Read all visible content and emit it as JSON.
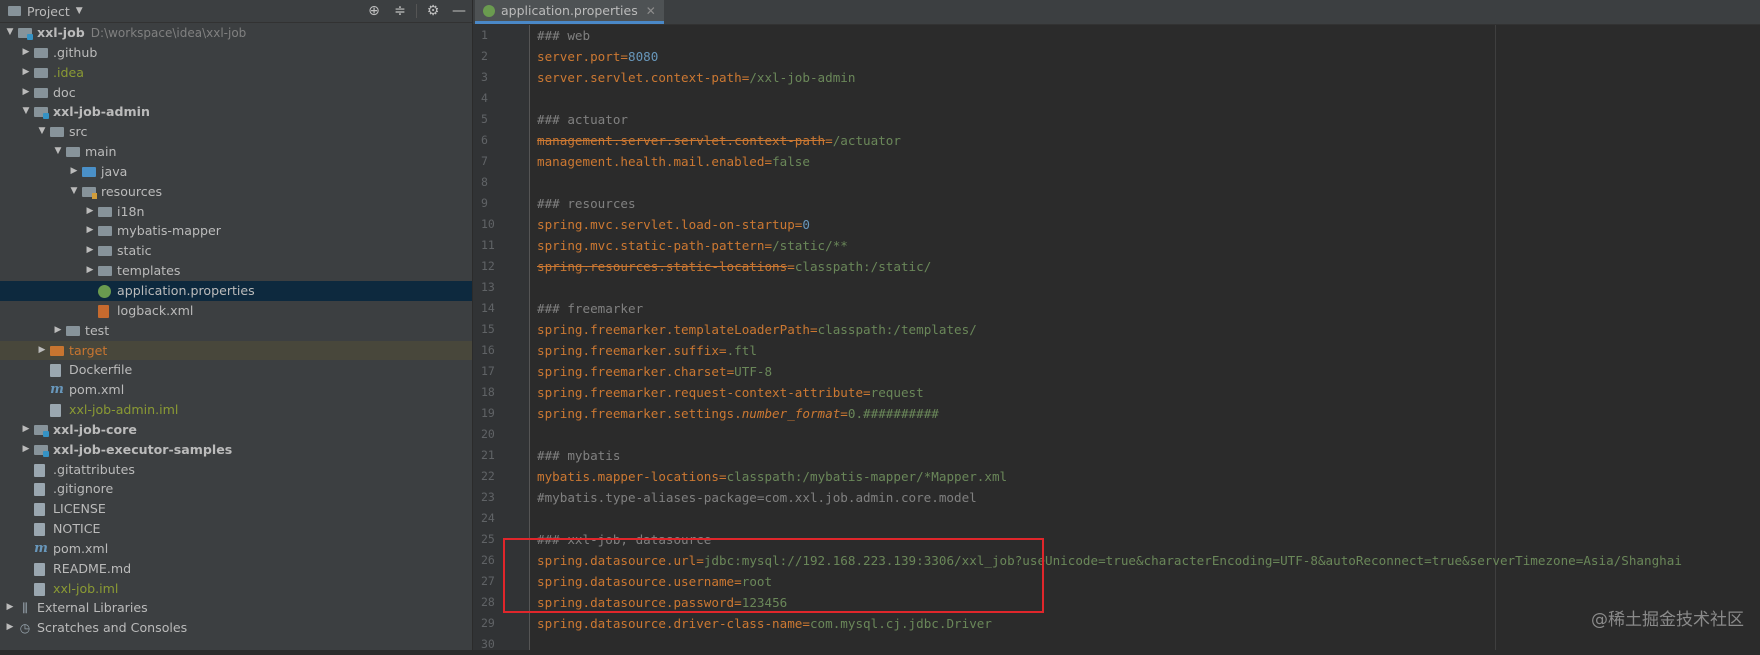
{
  "project_panel": {
    "title": "Project",
    "tree": [
      {
        "label": "xxl-job",
        "hint": "D:\\workspace\\idea\\xxl-job",
        "depth": 0,
        "type": "module",
        "expanded": true,
        "style": "bold"
      },
      {
        "label": ".github",
        "depth": 1,
        "type": "folder",
        "expanded": false,
        "style": "light"
      },
      {
        "label": ".idea",
        "depth": 1,
        "type": "folder",
        "expanded": false,
        "style": "green"
      },
      {
        "label": "doc",
        "depth": 1,
        "type": "folder",
        "expanded": false,
        "style": "light"
      },
      {
        "label": "xxl-job-admin",
        "depth": 1,
        "type": "module",
        "expanded": true,
        "style": "bold"
      },
      {
        "label": "src",
        "depth": 2,
        "type": "folder",
        "expanded": true,
        "style": "light"
      },
      {
        "label": "main",
        "depth": 3,
        "type": "folder",
        "expanded": true,
        "style": "light"
      },
      {
        "label": "java",
        "depth": 4,
        "type": "src",
        "expanded": false,
        "style": "light"
      },
      {
        "label": "resources",
        "depth": 4,
        "type": "res",
        "expanded": true,
        "style": "light"
      },
      {
        "label": "i18n",
        "depth": 5,
        "type": "folder",
        "expanded": false,
        "style": "light"
      },
      {
        "label": "mybatis-mapper",
        "depth": 5,
        "type": "folder",
        "expanded": false,
        "style": "light"
      },
      {
        "label": "static",
        "depth": 5,
        "type": "folder",
        "expanded": false,
        "style": "light"
      },
      {
        "label": "templates",
        "depth": 5,
        "type": "folder",
        "expanded": false,
        "style": "light"
      },
      {
        "label": "application.properties",
        "depth": 5,
        "type": "props",
        "style": "light",
        "selected": true
      },
      {
        "label": "logback.xml",
        "depth": 5,
        "type": "xml",
        "style": "light"
      },
      {
        "label": "test",
        "depth": 3,
        "type": "folder",
        "expanded": false,
        "style": "light"
      },
      {
        "label": "target",
        "depth": 2,
        "type": "excl",
        "expanded": false,
        "style": "orange",
        "excluded": true
      },
      {
        "label": "Dockerfile",
        "depth": 2,
        "type": "file",
        "style": "light"
      },
      {
        "label": "pom.xml",
        "depth": 2,
        "type": "pom",
        "style": "light"
      },
      {
        "label": "xxl-job-admin.iml",
        "depth": 2,
        "type": "iml",
        "style": "green"
      },
      {
        "label": "xxl-job-core",
        "depth": 1,
        "type": "module",
        "expanded": false,
        "style": "bold"
      },
      {
        "label": "xxl-job-executor-samples",
        "depth": 1,
        "type": "module",
        "expanded": false,
        "style": "bold"
      },
      {
        "label": ".gitattributes",
        "depth": 1,
        "type": "file",
        "style": "light"
      },
      {
        "label": ".gitignore",
        "depth": 1,
        "type": "file",
        "style": "light"
      },
      {
        "label": "LICENSE",
        "depth": 1,
        "type": "file",
        "style": "light"
      },
      {
        "label": "NOTICE",
        "depth": 1,
        "type": "file",
        "style": "light"
      },
      {
        "label": "pom.xml",
        "depth": 1,
        "type": "pom",
        "style": "light"
      },
      {
        "label": "README.md",
        "depth": 1,
        "type": "md",
        "style": "light"
      },
      {
        "label": "xxl-job.iml",
        "depth": 1,
        "type": "iml",
        "style": "green"
      },
      {
        "label": "External Libraries",
        "depth": 0,
        "type": "lib",
        "expanded": false,
        "style": "light"
      },
      {
        "label": "Scratches and Consoles",
        "depth": 0,
        "type": "scratch",
        "expanded": false,
        "style": "light"
      }
    ]
  },
  "editor": {
    "tab_label": "application.properties",
    "lines": [
      {
        "n": "1",
        "parts": [
          [
            "cmt",
            "### web"
          ]
        ]
      },
      {
        "n": "2",
        "parts": [
          [
            "key",
            "server.port"
          ],
          [
            "eq",
            "="
          ],
          [
            "num",
            "8080"
          ]
        ]
      },
      {
        "n": "3",
        "parts": [
          [
            "key",
            "server.servlet.context-path"
          ],
          [
            "eq",
            "="
          ],
          [
            "val",
            "/xxl-job-admin"
          ]
        ]
      },
      {
        "n": "4",
        "parts": []
      },
      {
        "n": "5",
        "parts": [
          [
            "cmt",
            "### actuator"
          ]
        ]
      },
      {
        "n": "6",
        "parts": [
          [
            "key strike",
            "management.server.servlet.context-path"
          ],
          [
            "eq",
            "="
          ],
          [
            "val",
            "/actuator"
          ]
        ]
      },
      {
        "n": "7",
        "parts": [
          [
            "key",
            "management.health.mail.enabled"
          ],
          [
            "eq",
            "="
          ],
          [
            "val",
            "false"
          ]
        ]
      },
      {
        "n": "8",
        "parts": []
      },
      {
        "n": "9",
        "parts": [
          [
            "cmt",
            "### resources"
          ]
        ]
      },
      {
        "n": "10",
        "parts": [
          [
            "key",
            "spring.mvc.servlet.load-on-startup"
          ],
          [
            "eq",
            "="
          ],
          [
            "num",
            "0"
          ]
        ]
      },
      {
        "n": "11",
        "parts": [
          [
            "key",
            "spring.mvc.static-path-pattern"
          ],
          [
            "eq",
            "="
          ],
          [
            "val",
            "/static/**"
          ]
        ]
      },
      {
        "n": "12",
        "parts": [
          [
            "key strike",
            "spring.resources.static-locations"
          ],
          [
            "eq",
            "="
          ],
          [
            "val",
            "classpath:/static/"
          ]
        ]
      },
      {
        "n": "13",
        "parts": []
      },
      {
        "n": "14",
        "parts": [
          [
            "cmt",
            "### freemarker"
          ]
        ]
      },
      {
        "n": "15",
        "parts": [
          [
            "key",
            "spring.freemarker.templateLoaderPath"
          ],
          [
            "eq",
            "="
          ],
          [
            "val",
            "classpath:/templates/"
          ]
        ]
      },
      {
        "n": "16",
        "parts": [
          [
            "key",
            "spring.freemarker.suffix"
          ],
          [
            "eq",
            "="
          ],
          [
            "val",
            ".ftl"
          ]
        ]
      },
      {
        "n": "17",
        "parts": [
          [
            "key",
            "spring.freemarker.charset"
          ],
          [
            "eq",
            "="
          ],
          [
            "val",
            "UTF-8"
          ]
        ]
      },
      {
        "n": "18",
        "parts": [
          [
            "key",
            "spring.freemarker.request-context-attribute"
          ],
          [
            "eq",
            "="
          ],
          [
            "val",
            "request"
          ]
        ]
      },
      {
        "n": "19",
        "parts": [
          [
            "key",
            "spring.freemarker.settings."
          ],
          [
            "key ital",
            "number_format"
          ],
          [
            "eq",
            "="
          ],
          [
            "val",
            "0.##########"
          ]
        ]
      },
      {
        "n": "20",
        "parts": []
      },
      {
        "n": "21",
        "parts": [
          [
            "cmt",
            "### mybatis"
          ]
        ]
      },
      {
        "n": "22",
        "parts": [
          [
            "key",
            "mybatis.mapper-locations"
          ],
          [
            "eq",
            "="
          ],
          [
            "val",
            "classpath:/mybatis-mapper/*Mapper.xml"
          ]
        ]
      },
      {
        "n": "23",
        "parts": [
          [
            "cmt",
            "#mybatis.type-aliases-package=com.xxl.job.admin.core.model"
          ]
        ]
      },
      {
        "n": "24",
        "parts": []
      },
      {
        "n": "25",
        "parts": [
          [
            "cmt",
            "### xxl-job, datasource"
          ]
        ]
      },
      {
        "n": "26",
        "parts": [
          [
            "key",
            "spring.datasource.url"
          ],
          [
            "eq",
            "="
          ],
          [
            "val",
            "jdbc:mysql://192.168.223.139:3306/xxl_job?useUnicode=true&characterEncoding=UTF-8&autoReconnect=true&serverTimezone=Asia/Shanghai"
          ]
        ]
      },
      {
        "n": "27",
        "parts": [
          [
            "key",
            "spring.datasource.username"
          ],
          [
            "eq",
            "="
          ],
          [
            "val",
            "root"
          ]
        ]
      },
      {
        "n": "28",
        "parts": [
          [
            "key",
            "spring.datasource.password"
          ],
          [
            "eq",
            "="
          ],
          [
            "val",
            "123456"
          ]
        ]
      },
      {
        "n": "29",
        "parts": [
          [
            "key",
            "spring.datasource.driver-class-name"
          ],
          [
            "eq",
            "="
          ],
          [
            "val",
            "com.mysql.cj.jdbc.Driver"
          ]
        ]
      },
      {
        "n": "30",
        "parts": []
      }
    ]
  },
  "watermark": "@稀土掘金技术社区",
  "colors": {
    "panel_bg": "#3c3f41",
    "editor_bg": "#2b2b2b",
    "key": "#cc7832",
    "value": "#6a8759",
    "number": "#6897bb",
    "comment": "#808080",
    "highlight": "#e0262b"
  }
}
